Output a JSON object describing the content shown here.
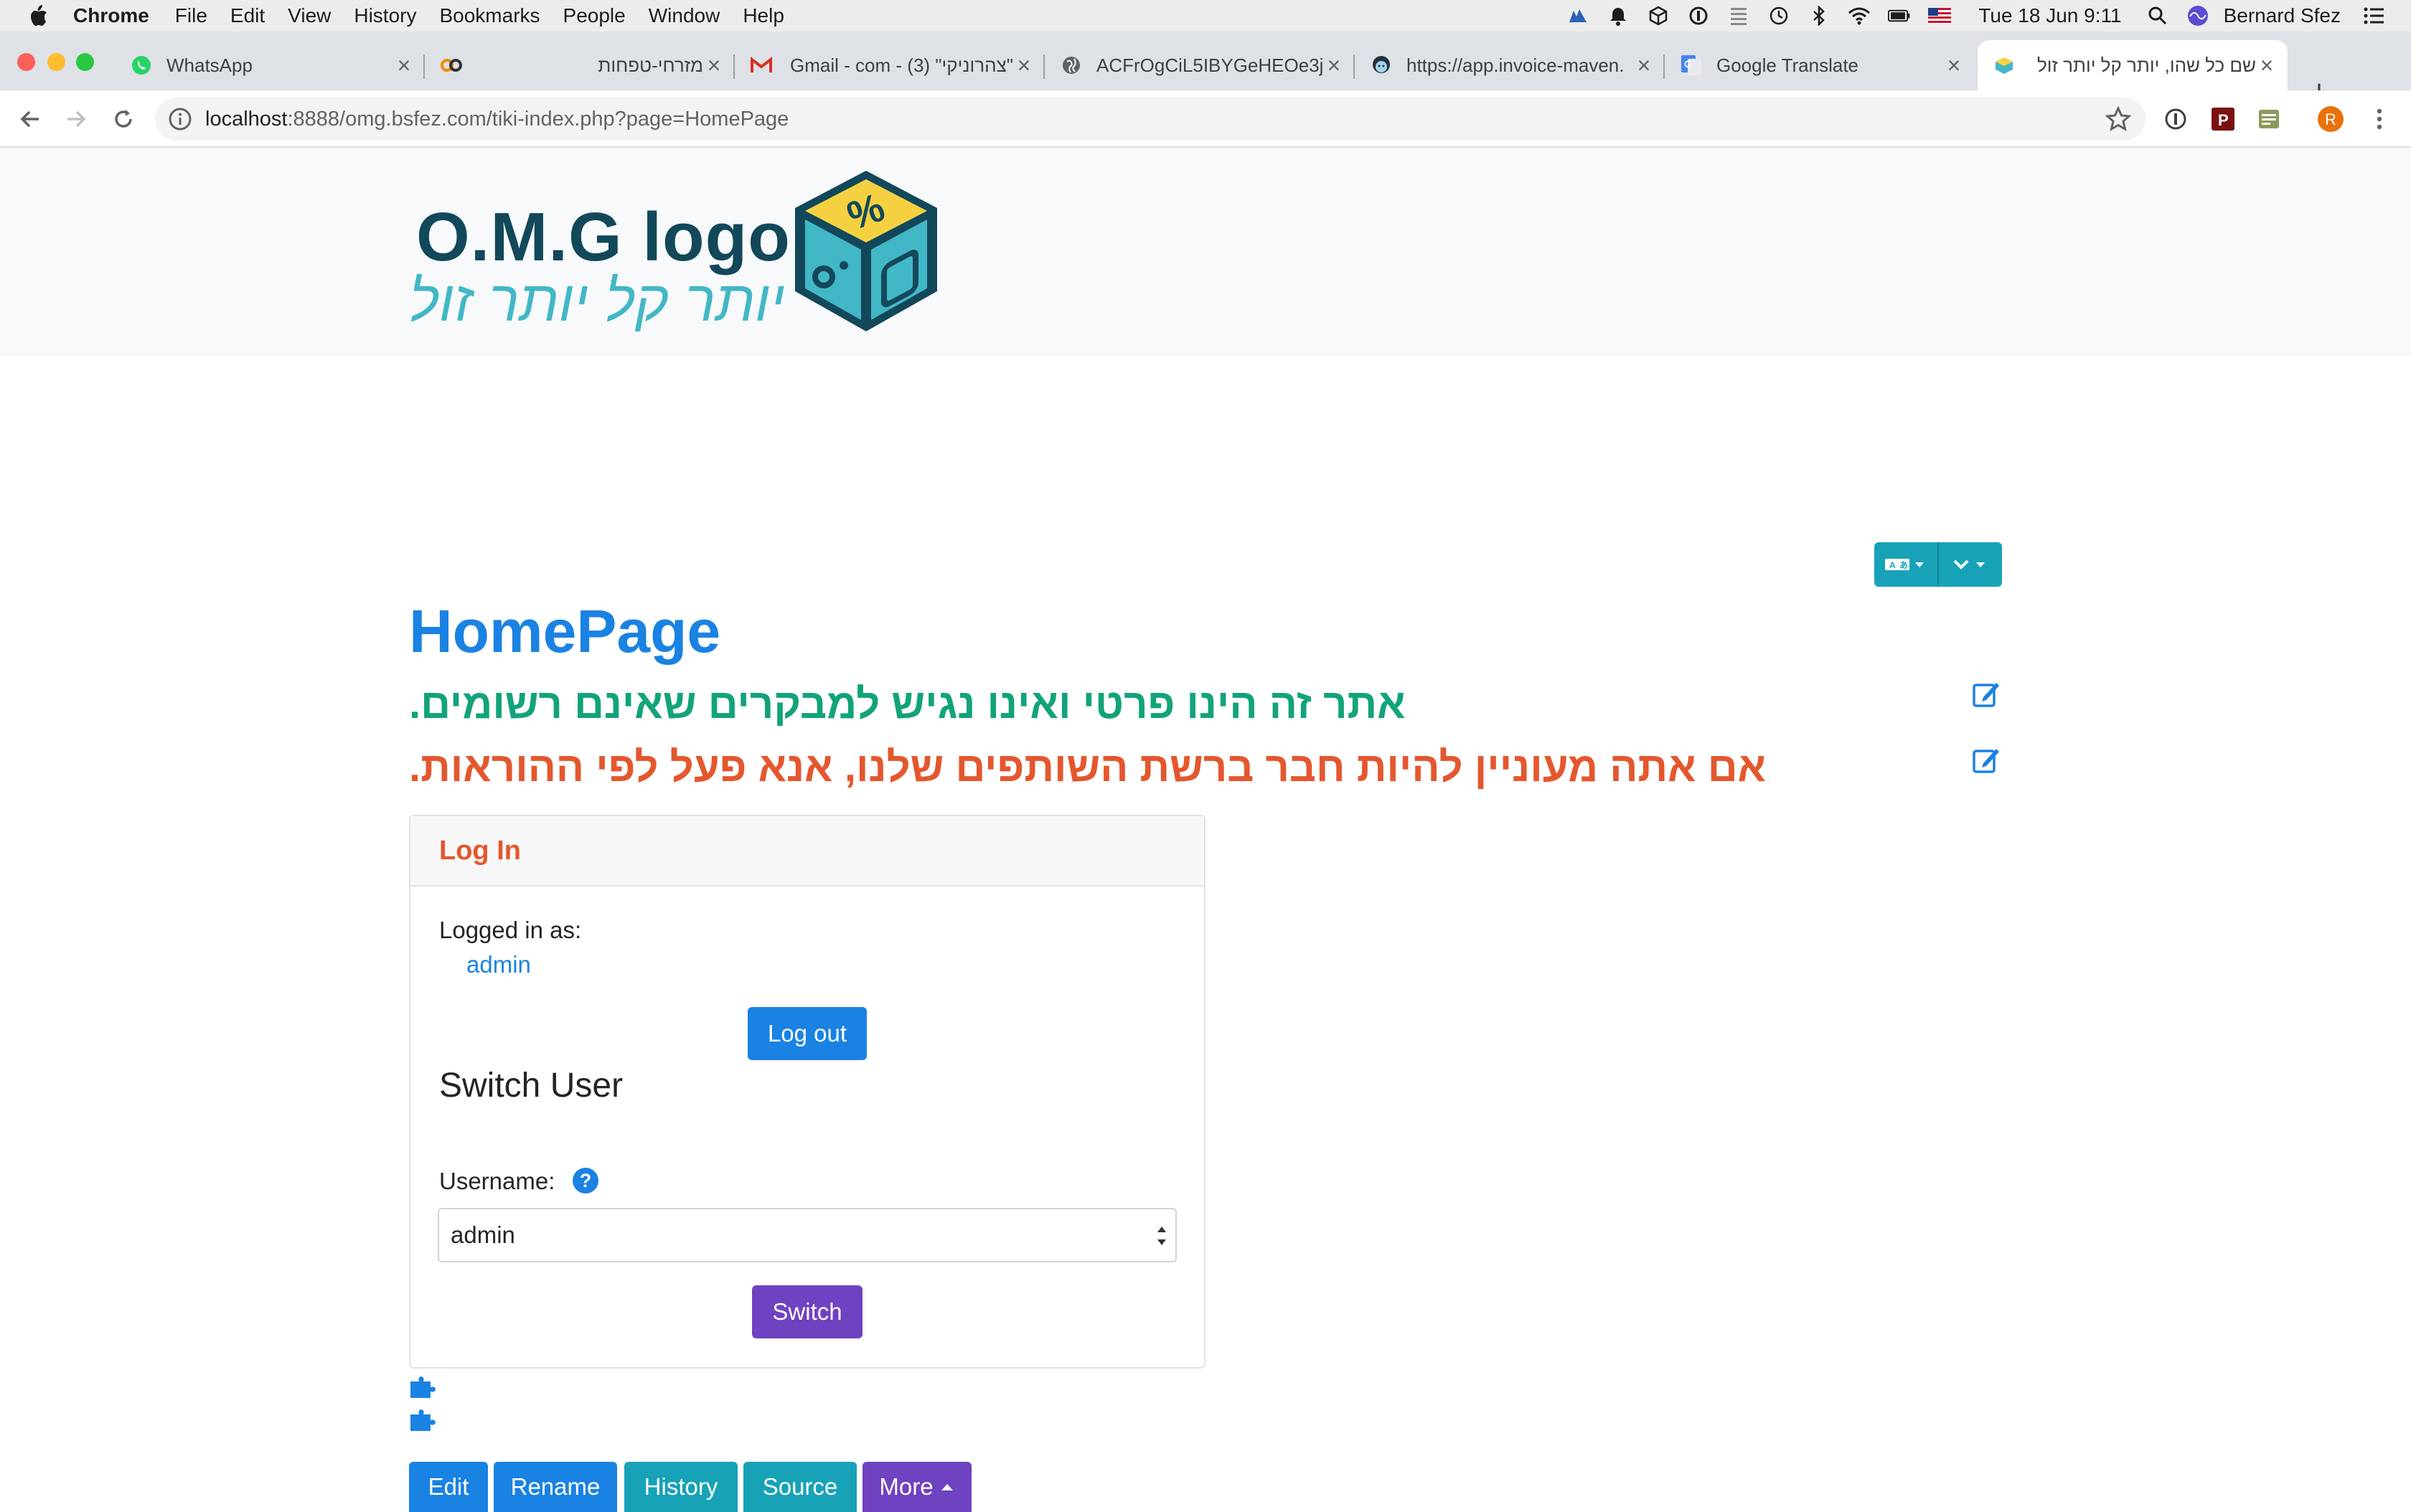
{
  "menubar": {
    "app_name": "Chrome",
    "menus": [
      "File",
      "Edit",
      "View",
      "History",
      "Bookmarks",
      "People",
      "Window",
      "Help"
    ],
    "clock": "Tue 18 Jun  9:11",
    "user": "Bernard Sfez"
  },
  "tabs": [
    {
      "title": "WhatsApp",
      "icon": "whatsapp-icon"
    },
    {
      "title": "מזרחי-טפחות",
      "icon": "mizrahi-icon"
    },
    {
      "title": "\"צהרוניקי\" (3) - Gmail - com",
      "icon": "gmail-icon"
    },
    {
      "title": "ACFrOgCiL5IBYGeHEOe3j",
      "icon": "globe-icon"
    },
    {
      "title": "https://app.invoice-maven.",
      "icon": "invoice-maven-icon"
    },
    {
      "title": "Google Translate",
      "icon": "google-translate-icon"
    },
    {
      "title": "שם כל שהו, יותר קל יותר זול",
      "icon": "site-icon"
    }
  ],
  "address_bar": {
    "host": "localhost",
    "rest": ":8888/omg.bsfez.com/tiki-index.php?page=HomePage"
  },
  "extensions": {
    "profile_initial": "R"
  },
  "logo": {
    "main": "O.M.G logo",
    "sub": "יותר קל יותר זול",
    "cube_glyph": "%"
  },
  "page": {
    "title": "HomePage",
    "notice_private": "אתר זה הינו פרטי ואינו נגיש למבקרים שאינם רשומים.",
    "notice_partner": "אם אתה מעוניין להיות חבר ברשת השותפים שלנו, אנא פעל לפי ההוראות."
  },
  "login_box": {
    "header": "Log In",
    "logged_in_label": "Logged in as:",
    "user": "admin",
    "logout_label": "Log out",
    "switch_title": "Switch User",
    "username_label": "Username:",
    "help_glyph": "?",
    "selected_user": "admin",
    "switch_label": "Switch"
  },
  "actions": {
    "edit": "Edit",
    "rename": "Rename",
    "history": "History",
    "source": "Source",
    "more": "More"
  },
  "colors": {
    "primary": "#1a82e2",
    "teal": "#17a2b8",
    "purple": "#6f42c1",
    "green_notice": "#12a37a",
    "red_notice": "#e4572e",
    "logo_dark": "#12485a",
    "logo_light": "#42b7c6"
  }
}
